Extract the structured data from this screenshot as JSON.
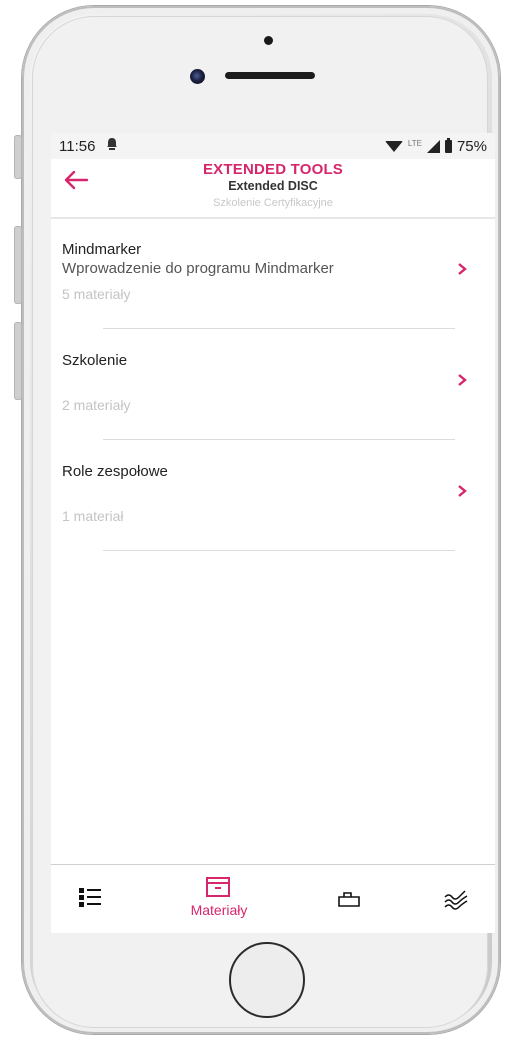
{
  "status_bar": {
    "time": "11:56",
    "lte": "LTE",
    "battery": "75%"
  },
  "header": {
    "title": "EXTENDED TOOLS",
    "subtitle": "Extended DISC",
    "caption": "Szkolenie Certyfikacyjne",
    "back_icon": "arrow-left-icon",
    "accent_color": "#d6266c"
  },
  "items": [
    {
      "title": "Mindmarker",
      "description": "Wprowadzenie do programu Mindmarker",
      "count": "5 materiały"
    },
    {
      "title": "Szkolenie",
      "description": "",
      "count": "2 materiały"
    },
    {
      "title": "Role zespołowe",
      "description": "",
      "count": "1 materiał"
    }
  ],
  "tab_bar": {
    "tabs": [
      {
        "icon": "list-icon",
        "label": ""
      },
      {
        "icon": "archive-box-icon",
        "label": "Materiały",
        "active": true
      },
      {
        "icon": "toolbox-icon",
        "label": ""
      },
      {
        "icon": "waves-icon",
        "label": ""
      }
    ]
  }
}
